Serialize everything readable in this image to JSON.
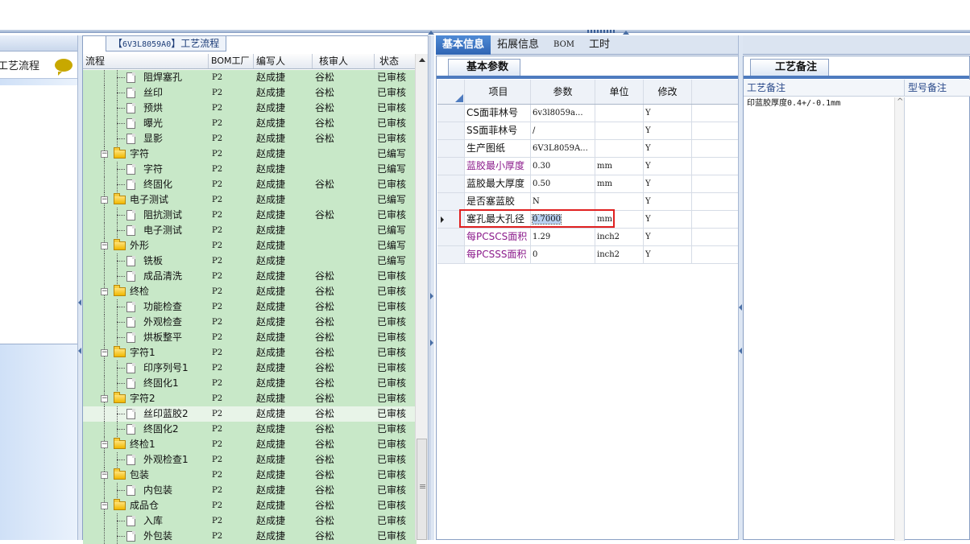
{
  "tree_panel": {
    "title_prefix": "【",
    "title_code": "6V3L8059A0",
    "title_suffix": "】工艺流程",
    "columns": [
      "流程",
      "BOM工厂",
      "编写人",
      "核审人",
      "状态"
    ],
    "rows": [
      {
        "type": "leaf",
        "name": "阻焊塞孔",
        "bom": "P2",
        "writer": "赵成捷",
        "reviewer": "谷松",
        "status": "已审核"
      },
      {
        "type": "leaf",
        "name": "丝印",
        "bom": "P2",
        "writer": "赵成捷",
        "reviewer": "谷松",
        "status": "已审核"
      },
      {
        "type": "leaf",
        "name": "预烘",
        "bom": "P2",
        "writer": "赵成捷",
        "reviewer": "谷松",
        "status": "已审核"
      },
      {
        "type": "leaf",
        "name": "曝光",
        "bom": "P2",
        "writer": "赵成捷",
        "reviewer": "谷松",
        "status": "已审核"
      },
      {
        "type": "leaf",
        "name": "显影",
        "bom": "P2",
        "writer": "赵成捷",
        "reviewer": "谷松",
        "status": "已审核"
      },
      {
        "type": "folder",
        "name": "字符",
        "bom": "P2",
        "writer": "赵成捷",
        "reviewer": "",
        "status": "已编写"
      },
      {
        "type": "leaf",
        "name": "字符",
        "bom": "P2",
        "writer": "赵成捷",
        "reviewer": "",
        "status": "已编写"
      },
      {
        "type": "leaf",
        "name": "终固化",
        "bom": "P2",
        "writer": "赵成捷",
        "reviewer": "谷松",
        "status": "已审核"
      },
      {
        "type": "folder",
        "name": "电子测试",
        "bom": "P2",
        "writer": "赵成捷",
        "reviewer": "",
        "status": "已编写"
      },
      {
        "type": "leaf",
        "name": "阻抗测试",
        "bom": "P2",
        "writer": "赵成捷",
        "reviewer": "谷松",
        "status": "已审核"
      },
      {
        "type": "leaf",
        "name": "电子测试",
        "bom": "P2",
        "writer": "赵成捷",
        "reviewer": "",
        "status": "已编写"
      },
      {
        "type": "folder",
        "name": "外形",
        "bom": "P2",
        "writer": "赵成捷",
        "reviewer": "",
        "status": "已编写"
      },
      {
        "type": "leaf",
        "name": "铣板",
        "bom": "P2",
        "writer": "赵成捷",
        "reviewer": "",
        "status": "已编写"
      },
      {
        "type": "leaf",
        "name": "成品清洗",
        "bom": "P2",
        "writer": "赵成捷",
        "reviewer": "谷松",
        "status": "已审核"
      },
      {
        "type": "folder",
        "name": "终检",
        "bom": "P2",
        "writer": "赵成捷",
        "reviewer": "谷松",
        "status": "已审核"
      },
      {
        "type": "leaf",
        "name": "功能检查",
        "bom": "P2",
        "writer": "赵成捷",
        "reviewer": "谷松",
        "status": "已审核"
      },
      {
        "type": "leaf",
        "name": "外观检查",
        "bom": "P2",
        "writer": "赵成捷",
        "reviewer": "谷松",
        "status": "已审核"
      },
      {
        "type": "leaf",
        "name": "烘板整平",
        "bom": "P2",
        "writer": "赵成捷",
        "reviewer": "谷松",
        "status": "已审核"
      },
      {
        "type": "folder",
        "name": "字符1",
        "bom": "P2",
        "writer": "赵成捷",
        "reviewer": "谷松",
        "status": "已审核"
      },
      {
        "type": "leaf",
        "name": "印序列号1",
        "bom": "P2",
        "writer": "赵成捷",
        "reviewer": "谷松",
        "status": "已审核"
      },
      {
        "type": "leaf",
        "name": "终固化1",
        "bom": "P2",
        "writer": "赵成捷",
        "reviewer": "谷松",
        "status": "已审核"
      },
      {
        "type": "folder",
        "name": "字符2",
        "bom": "P2",
        "writer": "赵成捷",
        "reviewer": "谷松",
        "status": "已审核"
      },
      {
        "type": "leaf",
        "name": "丝印蓝胶2",
        "bom": "P2",
        "writer": "赵成捷",
        "reviewer": "谷松",
        "status": "已审核",
        "selected": true
      },
      {
        "type": "leaf",
        "name": "终固化2",
        "bom": "P2",
        "writer": "赵成捷",
        "reviewer": "谷松",
        "status": "已审核"
      },
      {
        "type": "folder",
        "name": "终检1",
        "bom": "P2",
        "writer": "赵成捷",
        "reviewer": "谷松",
        "status": "已审核"
      },
      {
        "type": "leaf",
        "name": "外观检查1",
        "bom": "P2",
        "writer": "赵成捷",
        "reviewer": "谷松",
        "status": "已审核"
      },
      {
        "type": "folder",
        "name": "包装",
        "bom": "P2",
        "writer": "赵成捷",
        "reviewer": "谷松",
        "status": "已审核"
      },
      {
        "type": "leaf",
        "name": "内包装",
        "bom": "P2",
        "writer": "赵成捷",
        "reviewer": "谷松",
        "status": "已审核"
      },
      {
        "type": "folder",
        "name": "成品仓",
        "bom": "P2",
        "writer": "赵成捷",
        "reviewer": "谷松",
        "status": "已审核"
      },
      {
        "type": "leaf",
        "name": "入库",
        "bom": "P2",
        "writer": "赵成捷",
        "reviewer": "谷松",
        "status": "已审核"
      },
      {
        "type": "leaf",
        "name": "外包装",
        "bom": "P2",
        "writer": "赵成捷",
        "reviewer": "谷松",
        "status": "已审核"
      }
    ]
  },
  "left_strip": {
    "item_label": "工艺流程",
    "bubble_icon": "chat-bubble-icon"
  },
  "tabs": [
    "基本信息",
    "拓展信息",
    "BOM",
    "工时"
  ],
  "basic_params": {
    "subtab": "基本参数",
    "columns": [
      "项目",
      "参数",
      "单位",
      "修改"
    ],
    "rows": [
      {
        "item": "CS面菲林号",
        "param": "6v3l8059a...",
        "unit": "",
        "mod": "Y",
        "purple": false
      },
      {
        "item": "SS面菲林号",
        "param": "/",
        "unit": "",
        "mod": "Y",
        "purple": false
      },
      {
        "item": "生产图纸",
        "param": "6V3L8059A...",
        "unit": "",
        "mod": "Y",
        "purple": false
      },
      {
        "item": "蓝胶最小厚度",
        "param": "0.30",
        "unit": "mm",
        "mod": "Y",
        "purple": true
      },
      {
        "item": "蓝胶最大厚度",
        "param": "0.50",
        "unit": "mm",
        "mod": "Y",
        "purple": false
      },
      {
        "item": "是否塞蓝胶",
        "param": "N",
        "unit": "",
        "mod": "Y",
        "purple": false
      },
      {
        "item": "塞孔最大孔径",
        "param": "0.7000",
        "unit": "mm",
        "mod": "Y",
        "purple": false,
        "current": true
      },
      {
        "item": "每PCSCS面积",
        "param": "1.29",
        "unit": "inch2",
        "mod": "Y",
        "purple": true
      },
      {
        "item": "每PCSSS面积",
        "param": "0",
        "unit": "inch2",
        "mod": "Y",
        "purple": true
      }
    ]
  },
  "notes_panel": {
    "subtab": "工艺备注",
    "col_process": "工艺备注",
    "col_model": "型号备注",
    "process_note": "印蓝胶厚度0.4+/-0.1mm"
  },
  "colors": {
    "tree_row": "#c8e8c8",
    "tab_active": "#2f64b3",
    "purple_text": "#8b1a8b",
    "highlight_box": "#e02020"
  }
}
